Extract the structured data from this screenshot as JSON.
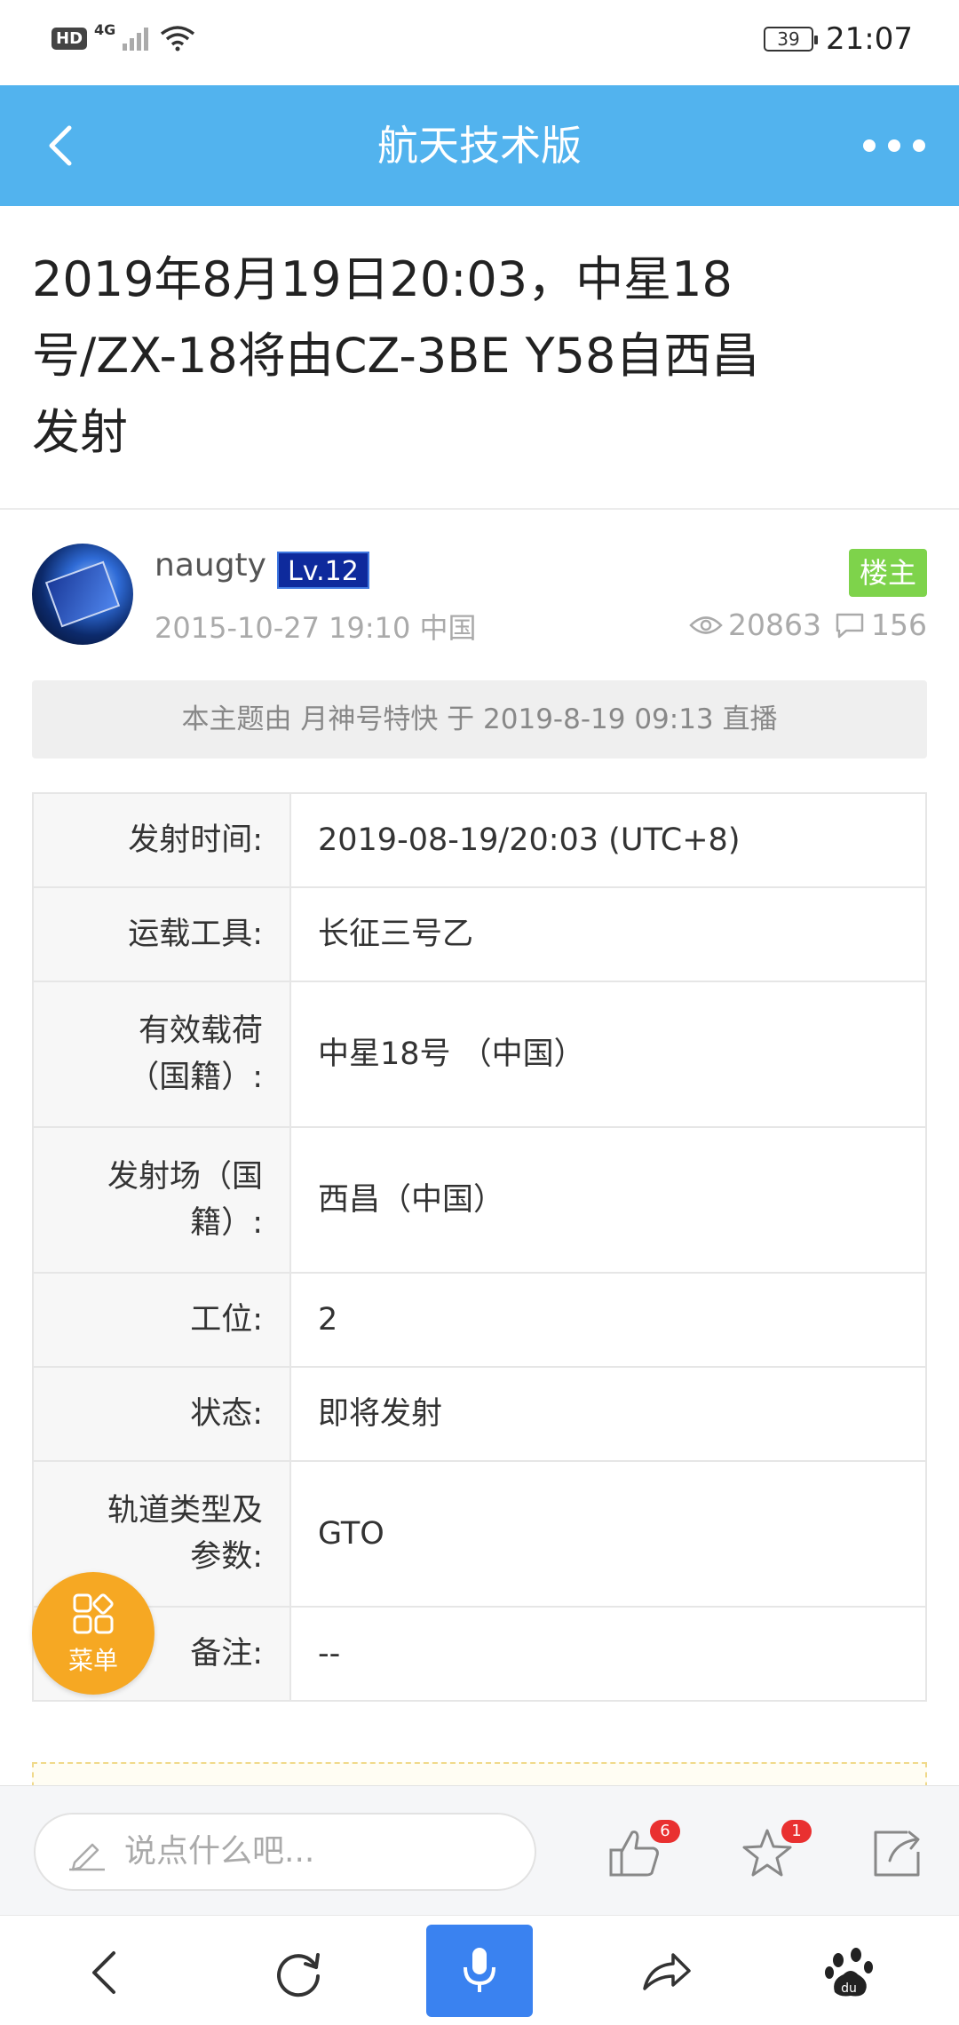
{
  "status_bar": {
    "hd": "HD",
    "network": "4G",
    "battery": "39",
    "time": "21:07"
  },
  "header": {
    "title": "航天技术版",
    "back_icon": "chevron-left-icon",
    "more_icon": "more-dots-icon"
  },
  "post": {
    "title_lines": [
      "2019年8月19日20:03，中星18",
      "号/ZX-18将由CZ-3BE Y58自西昌",
      "发射"
    ]
  },
  "author": {
    "name": "naugty",
    "level": "Lv.12",
    "badge": "楼主",
    "date": "2015-10-27 19:10",
    "location": "中国",
    "views": "20863",
    "replies": "156"
  },
  "notice": "本主题由 月神号特快 于 2019-8-19 09:13 直播",
  "table": {
    "rows": [
      {
        "key": "发射时间:",
        "value": "2019-08-19/20:03 (UTC+8)"
      },
      {
        "key_lines": [
          "有效载荷",
          "（国籍）:"
        ],
        "value": "中星18号 （中国）"
      },
      {
        "key": "运载工具:",
        "value": "长征三号乙"
      },
      {
        "key_lines": [
          "发射场（国",
          "籍）:"
        ],
        "value": "西昌（中国）"
      },
      {
        "key": "工位:",
        "value": "2"
      },
      {
        "key": "状态:",
        "value": "即将发射"
      },
      {
        "key_lines": [
          "轨道类型及",
          "参数:"
        ],
        "value": "GTO"
      },
      {
        "key": "备注:",
        "value": "--"
      }
    ]
  },
  "fab": {
    "label": "菜单",
    "color": "#f6a823"
  },
  "comment_bar": {
    "placeholder": "说点什么吧...",
    "like_count": "6",
    "favorite_count": "1"
  },
  "colors": {
    "header": "#52b3ee",
    "level_badge": "#0e2a9c",
    "op_badge": "#7ed34b",
    "mic": "#3a82f0"
  }
}
